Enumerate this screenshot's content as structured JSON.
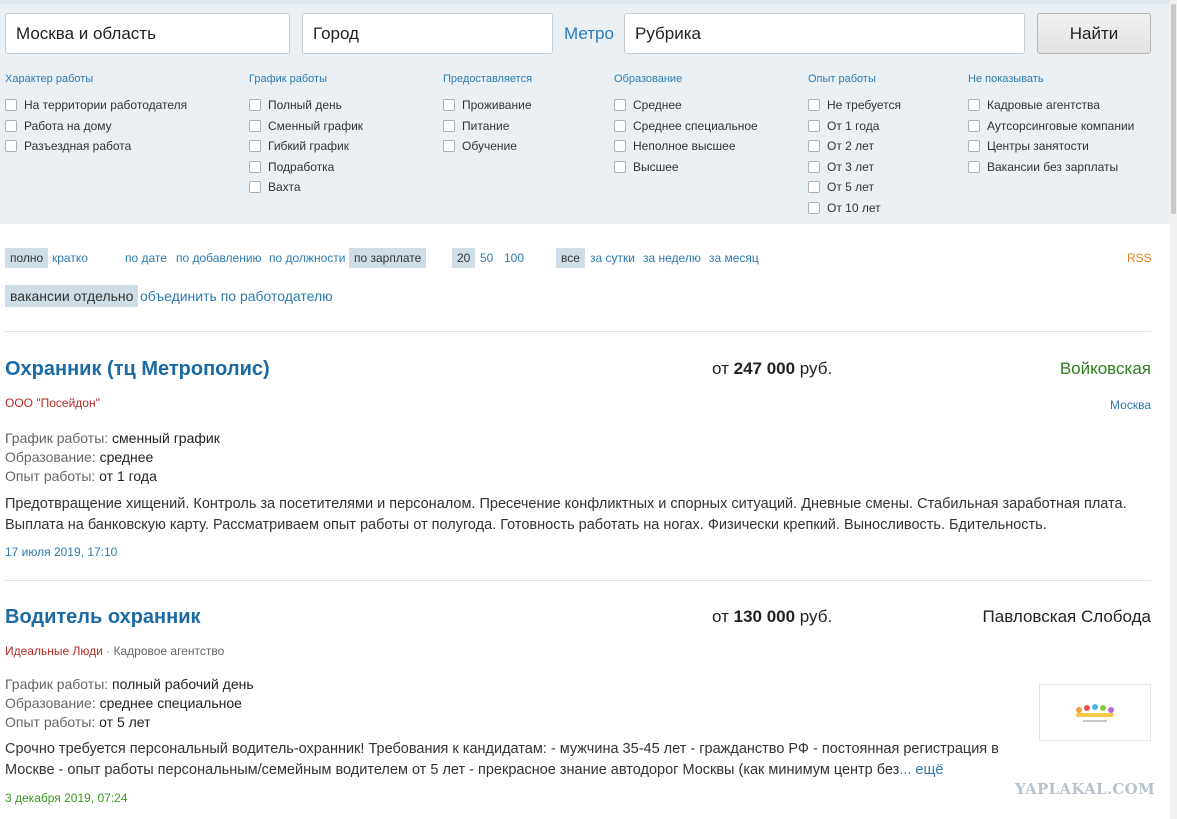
{
  "search": {
    "region": "Москва и область",
    "city_placeholder": "Город",
    "metro": "Метро",
    "rubric_placeholder": "Рубрика",
    "find_button": "Найти"
  },
  "filters": [
    {
      "title": "Характер работы",
      "options": [
        "На территории работодателя",
        "Работа на дому",
        "Разъездная работа"
      ]
    },
    {
      "title": "График работы",
      "options": [
        "Полный день",
        "Сменный график",
        "Гибкий график",
        "Подработка",
        "Вахта"
      ]
    },
    {
      "title": "Предоставляется",
      "options": [
        "Проживание",
        "Питание",
        "Обучение"
      ]
    },
    {
      "title": "Образование",
      "options": [
        "Среднее",
        "Среднее специальное",
        "Неполное высшее",
        "Высшее"
      ]
    },
    {
      "title": "Опыт работы",
      "options": [
        "Не требуется",
        "От 1 года",
        "От 2 лет",
        "От 3 лет",
        "От 5 лет",
        "От 10 лет"
      ]
    },
    {
      "title": "Не показывать",
      "options": [
        "Кадровые агентства",
        "Аутсорсинговые компании",
        "Центры занятости",
        "Вакансии без зарплаты"
      ]
    }
  ],
  "view": {
    "full": "полно",
    "short": "кратко"
  },
  "sort": {
    "by_date": "по дате",
    "by_added": "по добавлению",
    "by_position": "по должности",
    "by_salary": "по зарплате"
  },
  "per_page": {
    "p20": "20",
    "p50": "50",
    "p100": "100"
  },
  "period": {
    "all": "все",
    "day": "за сутки",
    "week": "за неделю",
    "month": "за месяц"
  },
  "rss": "RSS",
  "grouping": {
    "separate": "вакансии отдельно",
    "merge": "объединить по работодателю"
  },
  "labels": {
    "schedule": "График работы:",
    "education": "Образование:",
    "experience": "Опыт работы:"
  },
  "vacancies": [
    {
      "title": "Охранник (тц Метрополис)",
      "salary_prefix": "от",
      "salary": "247 000",
      "currency": "руб.",
      "place": "Войковская",
      "company": "ООО \"Посейдон\"",
      "city": "Москва",
      "schedule": "сменный график",
      "education": "среднее",
      "experience": "от 1 года",
      "description": "Предотвращение хищений. Контроль за посетителями и персоналом. Пресечение конфликтных и спорных ситуаций. Дневные смены. Стабильная заработная плата. Выплата на банковскую карту. Рассматриваем опыт работы от полугода. Готовность работать на ногах. Физически крепкий. Выносливость. Бдительность.",
      "date": "17 июля 2019, 17:10"
    },
    {
      "title": "Водитель охранник",
      "salary_prefix": "от",
      "salary": "130 000",
      "currency": "руб.",
      "place": "Павловская Слобода",
      "company": "Идеальные Люди",
      "company_separator": "·",
      "company_type": "Кадровое агентство",
      "schedule": "полный рабочий день",
      "education": "среднее специальное",
      "experience": "от 5 лет",
      "description": "Срочно требуется персональный водитель-охранник! Требования к кандидатам: - мужчина 35-45 лет - гражданство РФ - постоянная регистрация в Москве - опыт работы персональным/семейным водителем от 5 лет - прекрасное знание автодорог Москвы (как минимум центр без",
      "more": "... ещё",
      "date": "3 декабря 2019, 07:24"
    }
  ],
  "watermark": "YAPLAKAL.COM",
  "colors": {
    "link": "#2e7bb0",
    "title": "#1b6aa5",
    "company": "#b22a25",
    "place_green": "#2e7d1e",
    "date_blue": "#2e7bb0",
    "date_green": "#3a9a1e",
    "rss": "#d9831f",
    "filter_bg": "#eaf0f4",
    "active_bg": "#cfdee6"
  }
}
